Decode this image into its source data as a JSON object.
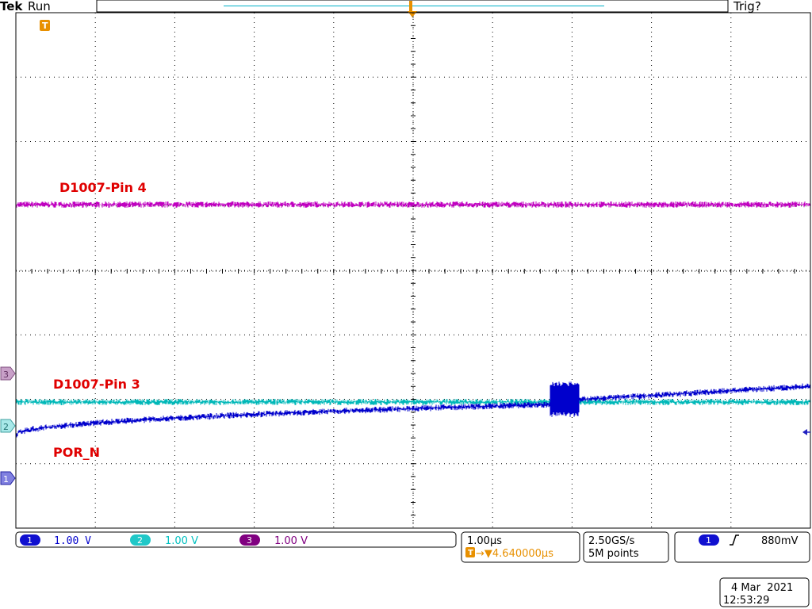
{
  "header": {
    "brand": "Tek",
    "run_state": "Run",
    "trigger_status": "Trig?",
    "trigger_marker": "T"
  },
  "traces": [
    {
      "channel": "4",
      "label": "D1007-Pin 4",
      "color": "#c000c0",
      "label_color": "#e00000"
    },
    {
      "channel": "3",
      "label": "D1007-Pin 3",
      "color": "#00b8b8",
      "label_color": "#e00000"
    },
    {
      "channel": "1",
      "label": "POR_N",
      "color": "#0000cc",
      "label_color": "#e00000"
    }
  ],
  "ground_markers": [
    {
      "number": "3",
      "color": "#a070a0"
    },
    {
      "number": "2",
      "color": "#70d0d0"
    },
    {
      "number": "1",
      "color": "#5050d0"
    }
  ],
  "channel_settings": [
    {
      "number": "1",
      "scale": "1.00 V",
      "color": "#0000cc"
    },
    {
      "number": "2",
      "scale": "1.00 V",
      "color": "#00c0c0"
    },
    {
      "number": "3",
      "scale": "1.00 V",
      "color": "#800080"
    }
  ],
  "timebase": {
    "scale": "1.00µs",
    "trigger_position": "→▼4.640000µs"
  },
  "acquisition": {
    "sample_rate": "2.50GS/s",
    "record_length": "5M points"
  },
  "trigger": {
    "source": "1",
    "slope_icon": "rising-edge-icon",
    "level": "880mV"
  },
  "datetime": {
    "date": "4 Mar  2021",
    "time": "12:53:29"
  },
  "colors": {
    "grid": "#000000",
    "trigger_orange": "#e89000",
    "panel_border": "#000000"
  }
}
